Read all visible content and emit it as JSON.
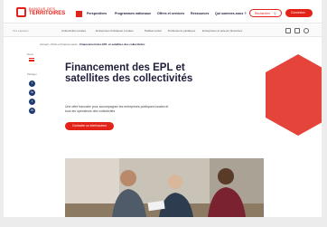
{
  "header": {
    "logo_line1": "BANQUE DES",
    "logo_line2": "TERRITOIRES",
    "nav": [
      "Perspectives",
      "Programmes nationaux",
      "Offres et services",
      "Ressources",
      "Qui sommes-nous ?"
    ],
    "search_label": "Rechercher",
    "connect_label": "Connexion"
  },
  "subnav": {
    "items": [
      "Vos espaces",
      "Collectivités locales",
      "Entreprises Publiques Locales",
      "Habitat social",
      "Professions juridiques",
      "Entreprises et acteurs financiers"
    ]
  },
  "breadcrumb": {
    "items": [
      "Accueil",
      "Prêts et financements",
      "Financement des EPL et satellites des collectivités"
    ]
  },
  "sidebar": {
    "share_label": "Partager",
    "menu_label": "Menu",
    "socials": [
      "f",
      "in",
      "t",
      "✉"
    ]
  },
  "hero": {
    "title": "Financement des EPL et satellites des collectivités",
    "description": "Une offre bancaire pour accompagner les entreprises publiques locales et tous les opérateurs des collectivités",
    "cta_label": "Contacter un interlocuteur"
  },
  "colors": {
    "accent": "#e2231a",
    "navy": "#1e1e3a",
    "hexagon": "#e5443b"
  }
}
